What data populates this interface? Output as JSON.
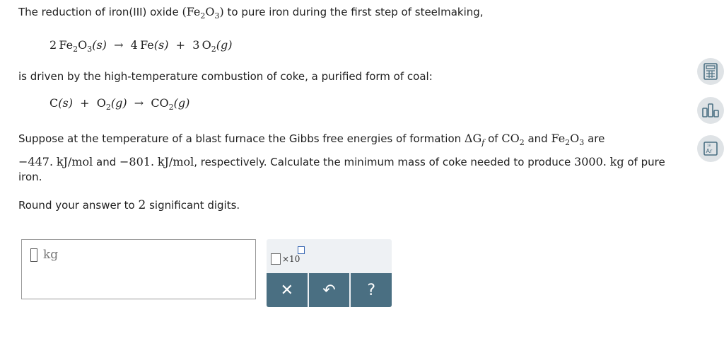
{
  "intro": {
    "text_before": "The reduction of iron(III) oxide ",
    "text_after": " to pure iron during the first step of steelmaking,"
  },
  "eq1": {
    "c1": "2",
    "r1": "Fe",
    "r1s1": "2",
    "r1o": "O",
    "r1s2": "3",
    "r1st": "(s)",
    "arrow": "→",
    "c2": "4",
    "p1": "Fe",
    "p1st": "(s)",
    "plus": "+",
    "c3": "3",
    "p2": "O",
    "p2s": "2",
    "p2st": "(g)"
  },
  "para2": "is driven by the high-temperature combustion of coke, a purified form of coal:",
  "eq2": {
    "r1": "C",
    "r1st": "(s)",
    "plus": "+",
    "r2": "O",
    "r2s": "2",
    "r2st": "(g)",
    "arrow": "→",
    "p1": "CO",
    "p1s": "2",
    "p1st": "(g)"
  },
  "para3": {
    "a": "Suppose at the temperature of a blast furnace the Gibbs free energies of formation ",
    "delta": "ΔG",
    "f": "f",
    "b": " of ",
    "co2": "CO",
    "co2s": "2",
    "c": " and ",
    "fe": "Fe",
    "fes1": "2",
    "o": "O",
    "fes2": "3",
    "d": " are"
  },
  "para3_line2": {
    "v1": "−447.",
    "u1": "kJ/mol",
    "and": " and ",
    "v2": "−801.",
    "u2": "kJ/mol",
    "rest": ", respectively. Calculate the minimum mass of coke needed to produce ",
    "mass": "3000.",
    "unit": "kg",
    "end": " of pure"
  },
  "para3_line3": "iron.",
  "round": {
    "a": "Round your answer to ",
    "n": "2",
    "b": " significant digits."
  },
  "answer": {
    "unit": "kg"
  },
  "tools": {
    "sci_label": "×10",
    "clear": "✕",
    "undo": "↶",
    "help": "?"
  },
  "side": {
    "periodic_label": "Ar"
  }
}
